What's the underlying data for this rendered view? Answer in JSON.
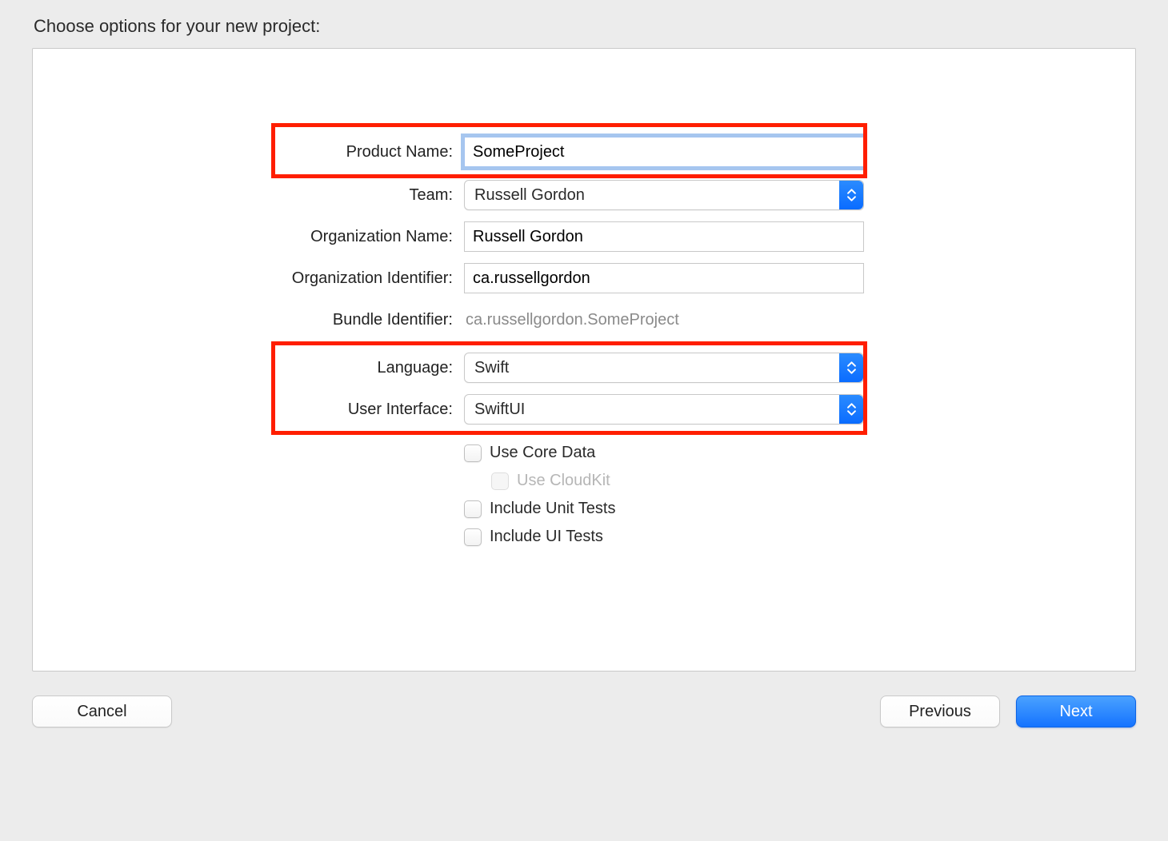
{
  "title": "Choose options for your new project:",
  "labels": {
    "product_name": "Product Name:",
    "team": "Team:",
    "org_name": "Organization Name:",
    "org_id": "Organization Identifier:",
    "bundle_id": "Bundle Identifier:",
    "language": "Language:",
    "ui": "User Interface:"
  },
  "values": {
    "product_name": "SomeProject",
    "team": "Russell Gordon",
    "org_name": "Russell Gordon",
    "org_id": "ca.russellgordon",
    "bundle_id": "ca.russellgordon.SomeProject",
    "language": "Swift",
    "ui": "SwiftUI"
  },
  "checkboxes": {
    "core_data": "Use Core Data",
    "cloudkit": "Use CloudKit",
    "unit_tests": "Include Unit Tests",
    "ui_tests": "Include UI Tests"
  },
  "buttons": {
    "cancel": "Cancel",
    "previous": "Previous",
    "next": "Next"
  }
}
